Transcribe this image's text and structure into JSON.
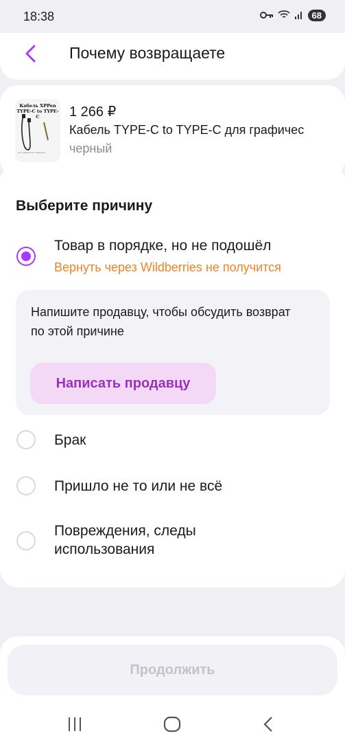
{
  "status_bar": {
    "time": "18:38",
    "battery": "68"
  },
  "header": {
    "title": "Почему возвращаете"
  },
  "product": {
    "thumb_title": "Кабель XPPen TYPE-C to TYPE-C",
    "thumb_small": "для графических планшетов",
    "price": "1 266 ₽",
    "name": "Кабель TYPE-C to TYPE-C для графичес",
    "color": "черный"
  },
  "reasons": {
    "title": "Выберите причину",
    "options": [
      {
        "label": "Товар в порядке, но не подошёл",
        "sub": "Вернуть через Wildberries не получится",
        "selected": true
      },
      {
        "label": "Брак",
        "selected": false
      },
      {
        "label": "Пришло не то или не всё",
        "selected": false
      },
      {
        "label": "Повреждения, следы использования",
        "selected": false
      }
    ],
    "seller_note": {
      "text": "Напишите продавцу, чтобы обсудить возврат по этой причине",
      "button": "Написать продавцу"
    }
  },
  "footer": {
    "continue_label": "Продолжить"
  },
  "colors": {
    "accent": "#a73afd",
    "warning": "#f0832a",
    "seller_button_text": "#9a32b8",
    "seller_button_bg": "#f4d9f7",
    "disabled_text": "#c4c2cc"
  },
  "icons": [
    "back-arrow-icon",
    "key-icon",
    "wifi-icon",
    "signal-icon",
    "battery-icon",
    "nav-recents-icon",
    "nav-home-icon",
    "nav-back-icon"
  ]
}
